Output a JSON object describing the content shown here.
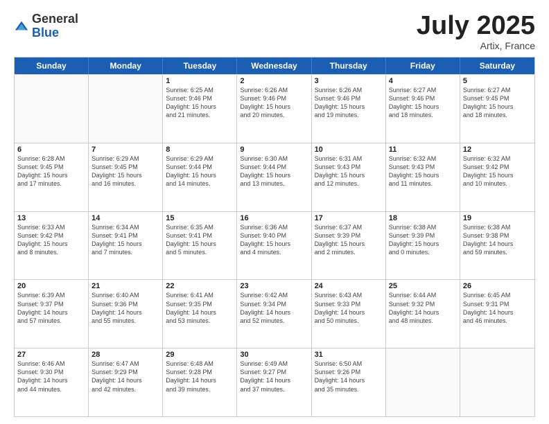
{
  "header": {
    "logo_general": "General",
    "logo_blue": "Blue",
    "month_title": "July 2025",
    "location": "Artix, France"
  },
  "days_of_week": [
    "Sunday",
    "Monday",
    "Tuesday",
    "Wednesday",
    "Thursday",
    "Friday",
    "Saturday"
  ],
  "weeks": [
    [
      {
        "day": "",
        "empty": true,
        "info": ""
      },
      {
        "day": "",
        "empty": true,
        "info": ""
      },
      {
        "day": "1",
        "info": "Sunrise: 6:25 AM\nSunset: 9:46 PM\nDaylight: 15 hours\nand 21 minutes."
      },
      {
        "day": "2",
        "info": "Sunrise: 6:26 AM\nSunset: 9:46 PM\nDaylight: 15 hours\nand 20 minutes."
      },
      {
        "day": "3",
        "info": "Sunrise: 6:26 AM\nSunset: 9:46 PM\nDaylight: 15 hours\nand 19 minutes."
      },
      {
        "day": "4",
        "info": "Sunrise: 6:27 AM\nSunset: 9:46 PM\nDaylight: 15 hours\nand 18 minutes."
      },
      {
        "day": "5",
        "info": "Sunrise: 6:27 AM\nSunset: 9:45 PM\nDaylight: 15 hours\nand 18 minutes."
      }
    ],
    [
      {
        "day": "6",
        "info": "Sunrise: 6:28 AM\nSunset: 9:45 PM\nDaylight: 15 hours\nand 17 minutes."
      },
      {
        "day": "7",
        "info": "Sunrise: 6:29 AM\nSunset: 9:45 PM\nDaylight: 15 hours\nand 16 minutes."
      },
      {
        "day": "8",
        "info": "Sunrise: 6:29 AM\nSunset: 9:44 PM\nDaylight: 15 hours\nand 14 minutes."
      },
      {
        "day": "9",
        "info": "Sunrise: 6:30 AM\nSunset: 9:44 PM\nDaylight: 15 hours\nand 13 minutes."
      },
      {
        "day": "10",
        "info": "Sunrise: 6:31 AM\nSunset: 9:43 PM\nDaylight: 15 hours\nand 12 minutes."
      },
      {
        "day": "11",
        "info": "Sunrise: 6:32 AM\nSunset: 9:43 PM\nDaylight: 15 hours\nand 11 minutes."
      },
      {
        "day": "12",
        "info": "Sunrise: 6:32 AM\nSunset: 9:42 PM\nDaylight: 15 hours\nand 10 minutes."
      }
    ],
    [
      {
        "day": "13",
        "info": "Sunrise: 6:33 AM\nSunset: 9:42 PM\nDaylight: 15 hours\nand 8 minutes."
      },
      {
        "day": "14",
        "info": "Sunrise: 6:34 AM\nSunset: 9:41 PM\nDaylight: 15 hours\nand 7 minutes."
      },
      {
        "day": "15",
        "info": "Sunrise: 6:35 AM\nSunset: 9:41 PM\nDaylight: 15 hours\nand 5 minutes."
      },
      {
        "day": "16",
        "info": "Sunrise: 6:36 AM\nSunset: 9:40 PM\nDaylight: 15 hours\nand 4 minutes."
      },
      {
        "day": "17",
        "info": "Sunrise: 6:37 AM\nSunset: 9:39 PM\nDaylight: 15 hours\nand 2 minutes."
      },
      {
        "day": "18",
        "info": "Sunrise: 6:38 AM\nSunset: 9:39 PM\nDaylight: 15 hours\nand 0 minutes."
      },
      {
        "day": "19",
        "info": "Sunrise: 6:38 AM\nSunset: 9:38 PM\nDaylight: 14 hours\nand 59 minutes."
      }
    ],
    [
      {
        "day": "20",
        "info": "Sunrise: 6:39 AM\nSunset: 9:37 PM\nDaylight: 14 hours\nand 57 minutes."
      },
      {
        "day": "21",
        "info": "Sunrise: 6:40 AM\nSunset: 9:36 PM\nDaylight: 14 hours\nand 55 minutes."
      },
      {
        "day": "22",
        "info": "Sunrise: 6:41 AM\nSunset: 9:35 PM\nDaylight: 14 hours\nand 53 minutes."
      },
      {
        "day": "23",
        "info": "Sunrise: 6:42 AM\nSunset: 9:34 PM\nDaylight: 14 hours\nand 52 minutes."
      },
      {
        "day": "24",
        "info": "Sunrise: 6:43 AM\nSunset: 9:33 PM\nDaylight: 14 hours\nand 50 minutes."
      },
      {
        "day": "25",
        "info": "Sunrise: 6:44 AM\nSunset: 9:32 PM\nDaylight: 14 hours\nand 48 minutes."
      },
      {
        "day": "26",
        "info": "Sunrise: 6:45 AM\nSunset: 9:31 PM\nDaylight: 14 hours\nand 46 minutes."
      }
    ],
    [
      {
        "day": "27",
        "info": "Sunrise: 6:46 AM\nSunset: 9:30 PM\nDaylight: 14 hours\nand 44 minutes."
      },
      {
        "day": "28",
        "info": "Sunrise: 6:47 AM\nSunset: 9:29 PM\nDaylight: 14 hours\nand 42 minutes."
      },
      {
        "day": "29",
        "info": "Sunrise: 6:48 AM\nSunset: 9:28 PM\nDaylight: 14 hours\nand 39 minutes."
      },
      {
        "day": "30",
        "info": "Sunrise: 6:49 AM\nSunset: 9:27 PM\nDaylight: 14 hours\nand 37 minutes."
      },
      {
        "day": "31",
        "info": "Sunrise: 6:50 AM\nSunset: 9:26 PM\nDaylight: 14 hours\nand 35 minutes."
      },
      {
        "day": "",
        "empty": true,
        "info": ""
      },
      {
        "day": "",
        "empty": true,
        "info": ""
      }
    ]
  ]
}
